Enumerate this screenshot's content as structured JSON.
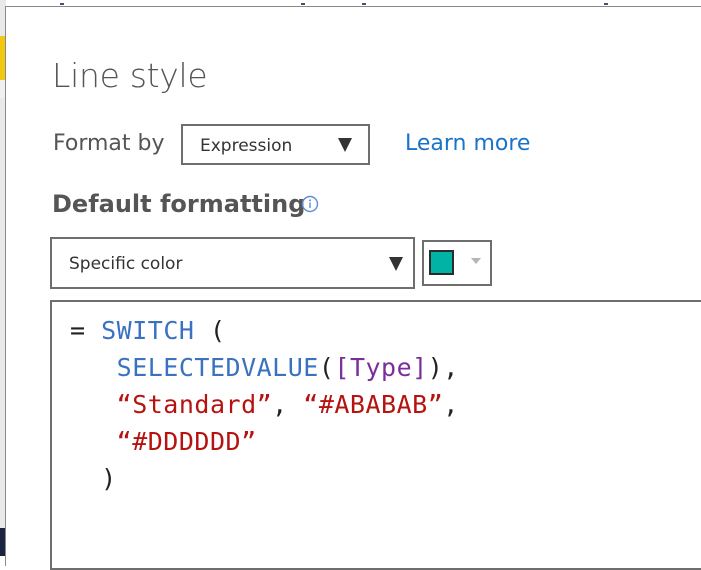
{
  "dialog": {
    "title": "Line style",
    "format_by": {
      "label": "Format by",
      "selected": "Expression",
      "learn_more": "Learn more"
    },
    "default_formatting": {
      "heading": "Default formatting",
      "info_icon": "info-circle-icon",
      "selected": "Specific color",
      "swatch_color": "#00B3A4"
    },
    "expression": {
      "lines": [
        [
          {
            "t": "= ",
            "c": "pl"
          },
          {
            "t": "SWITCH",
            "c": "kw"
          },
          {
            "t": " (",
            "c": "pl"
          }
        ],
        [
          {
            "t": "   ",
            "c": "pl"
          },
          {
            "t": "SELECTEDVALUE",
            "c": "kw"
          },
          {
            "t": "(",
            "c": "pl"
          },
          {
            "t": "[Type]",
            "c": "col"
          },
          {
            "t": "),",
            "c": "pl"
          }
        ],
        [
          {
            "t": "   ",
            "c": "pl"
          },
          {
            "t": "“Standard”",
            "c": "str"
          },
          {
            "t": ", ",
            "c": "pl"
          },
          {
            "t": "“#ABABAB”",
            "c": "str"
          },
          {
            "t": ",",
            "c": "pl"
          }
        ],
        [
          {
            "t": "   ",
            "c": "pl"
          },
          {
            "t": "“#DDDDDD”",
            "c": "str"
          }
        ],
        [
          {
            "t": "  )",
            "c": "pl"
          }
        ]
      ]
    }
  },
  "colors": {
    "accent_link": "#1A73C8",
    "keyword": "#3A72C0",
    "column": "#7A2E9E",
    "string": "#B5130F",
    "brand_yellow": "#F2C811"
  }
}
